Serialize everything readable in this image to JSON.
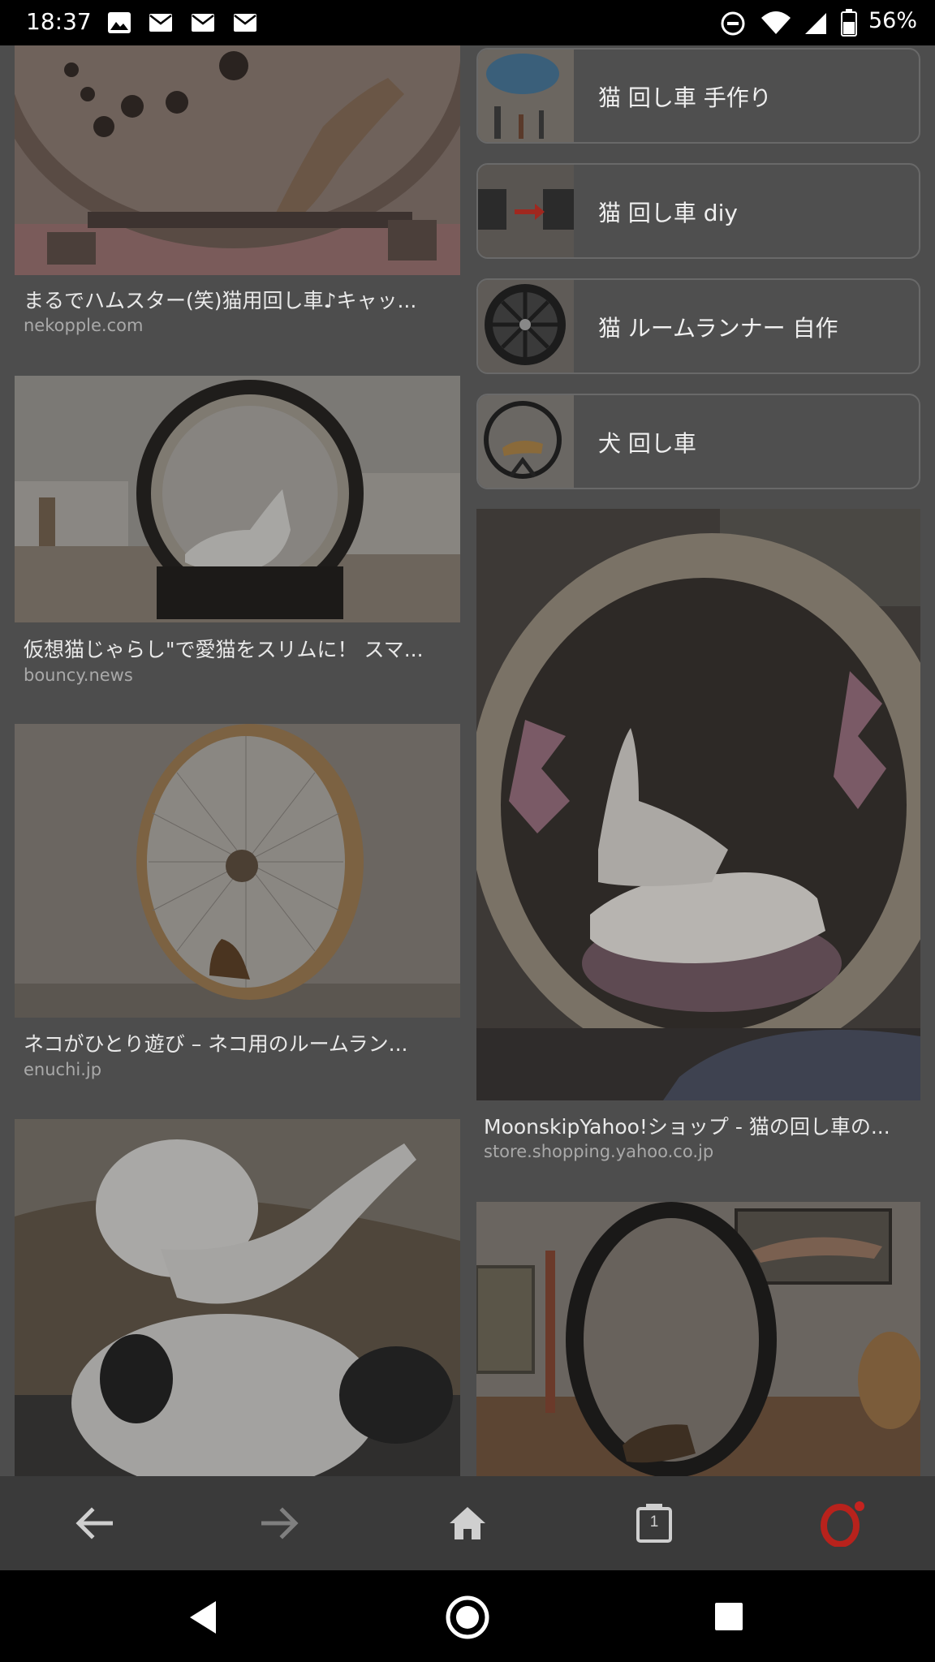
{
  "status_bar": {
    "time": "18:37",
    "battery": "56%",
    "notification_icons": [
      "image-icon",
      "mail-icon",
      "mail-icon",
      "mail-icon"
    ],
    "system_icons": [
      "do-not-disturb-icon",
      "wifi-icon",
      "signal-icon",
      "battery-icon"
    ]
  },
  "left_column": [
    {
      "caption": "まるでハムスター(笑)猫用回し車♪キャッ...",
      "domain": "nekopple.com",
      "image": "cat-wheel-bengal-paws"
    },
    {
      "caption": "仮想猫じゃらし\"で愛猫をスリムに！ スマ...",
      "domain": "bouncy.news",
      "image": "cat-wheel-white-room"
    },
    {
      "caption": "ネコがひとり遊び – ネコ用のルームラン...",
      "domain": "enuchi.jp",
      "image": "cat-wheel-spokes"
    },
    {
      "caption": "",
      "domain": "",
      "image": "two-white-cats"
    }
  ],
  "related_searches": [
    {
      "label": "猫 回し車 手作り"
    },
    {
      "label": "猫 回し車 diy"
    },
    {
      "label": "猫 ルームランナー 自作"
    },
    {
      "label": "犬 回し車"
    }
  ],
  "right_column": [
    {
      "caption": "MoonskipYahoo!ショップ - 猫の回し車の...",
      "domain": "store.shopping.yahoo.co.jp",
      "image": "white-cats-in-wheel"
    },
    {
      "caption": "",
      "domain": "",
      "image": "black-wheel-bengal"
    }
  ],
  "browser_nav": {
    "back": "back-arrow-icon",
    "forward": "forward-arrow-icon",
    "home": "home-icon",
    "tabs_count": "1",
    "menu": "opera-icon"
  },
  "system_nav": [
    "back-triangle-icon",
    "home-circle-icon",
    "recents-square-icon"
  ],
  "colors": {
    "dim_bg": "#4d4d4d",
    "opera_red": "#c4231f",
    "status_bg": "#000000"
  }
}
